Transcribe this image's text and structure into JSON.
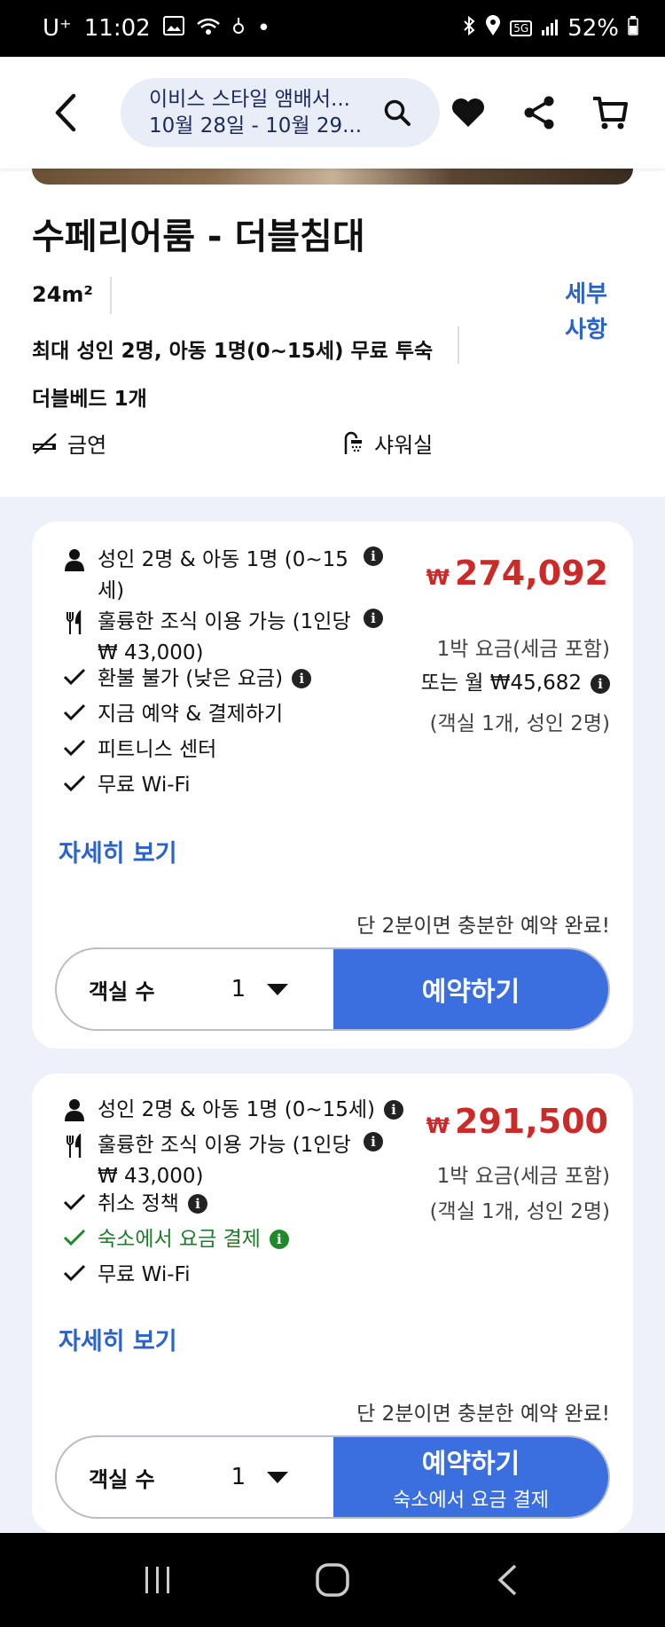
{
  "status_bar": {
    "carrier": "U⁺",
    "time": "11:02",
    "network": "5G",
    "battery": "52%"
  },
  "header": {
    "hotel_name": "이비스 스타일 앰배서...",
    "dates": "10월 28일 - 10월 29..."
  },
  "room": {
    "title": "수페리어룸 - 더블침대",
    "size": "24m²",
    "occupancy": "최대 성인 2명, 아동 1명(0~15세) 무료 투숙",
    "bed": "더블베드 1개",
    "details_link": "세부\n사항",
    "amenities": [
      {
        "icon": "no-smoking-icon",
        "label": "금연"
      },
      {
        "icon": "shower-icon",
        "label": "샤워실"
      }
    ]
  },
  "offers": [
    {
      "guests": "성인 2명 & 아동 1명 (0~15\n세)",
      "breakfast": "훌륭한 조식 이용 가능 (1인당\n₩ 43,000)",
      "features": [
        {
          "label": "환불 불가 (낮은 요금)",
          "info": true,
          "green": false
        },
        {
          "label": "지금 예약 & 결제하기",
          "info": false,
          "green": false
        },
        {
          "label": "피트니스 센터",
          "info": false,
          "green": false
        },
        {
          "label": "무료 Wi-Fi",
          "info": false,
          "green": false
        }
      ],
      "currency": "₩",
      "price": "274,092",
      "price_note": "1박 요금(세금 포함)",
      "monthly": "또는 월 ₩45,682",
      "room_note": "(객실 1개, 성인 2명)",
      "more": "자세히 보기",
      "hint": "단 2분이면 충분한 예약 완료!",
      "rooms_label": "객실 수",
      "rooms_value": "1",
      "book_label": "예약하기",
      "book_note": ""
    },
    {
      "guests": "성인 2명 & 아동 1명 (0~15세)",
      "breakfast": "훌륭한 조식 이용 가능 (1인당\n₩ 43,000)",
      "features": [
        {
          "label": "취소 정책",
          "info": true,
          "green": false
        },
        {
          "label": "숙소에서 요금 결제",
          "info": true,
          "green": true
        },
        {
          "label": "무료 Wi-Fi",
          "info": false,
          "green": false
        }
      ],
      "currency": "₩",
      "price": "291,500",
      "price_note": "1박 요금(세금 포함)",
      "room_note": "(객실 1개, 성인 2명)",
      "more": "자세히 보기",
      "hint": "단 2분이면 충분한 예약 완료!",
      "rooms_label": "객실 수",
      "rooms_value": "1",
      "book_label": "예약하기",
      "book_note": "숙소에서 요금 결제"
    }
  ],
  "colors": {
    "accent": "#3b6fe0",
    "price": "#cc2929",
    "link": "#2a63c9",
    "green": "#1f7a2b"
  }
}
